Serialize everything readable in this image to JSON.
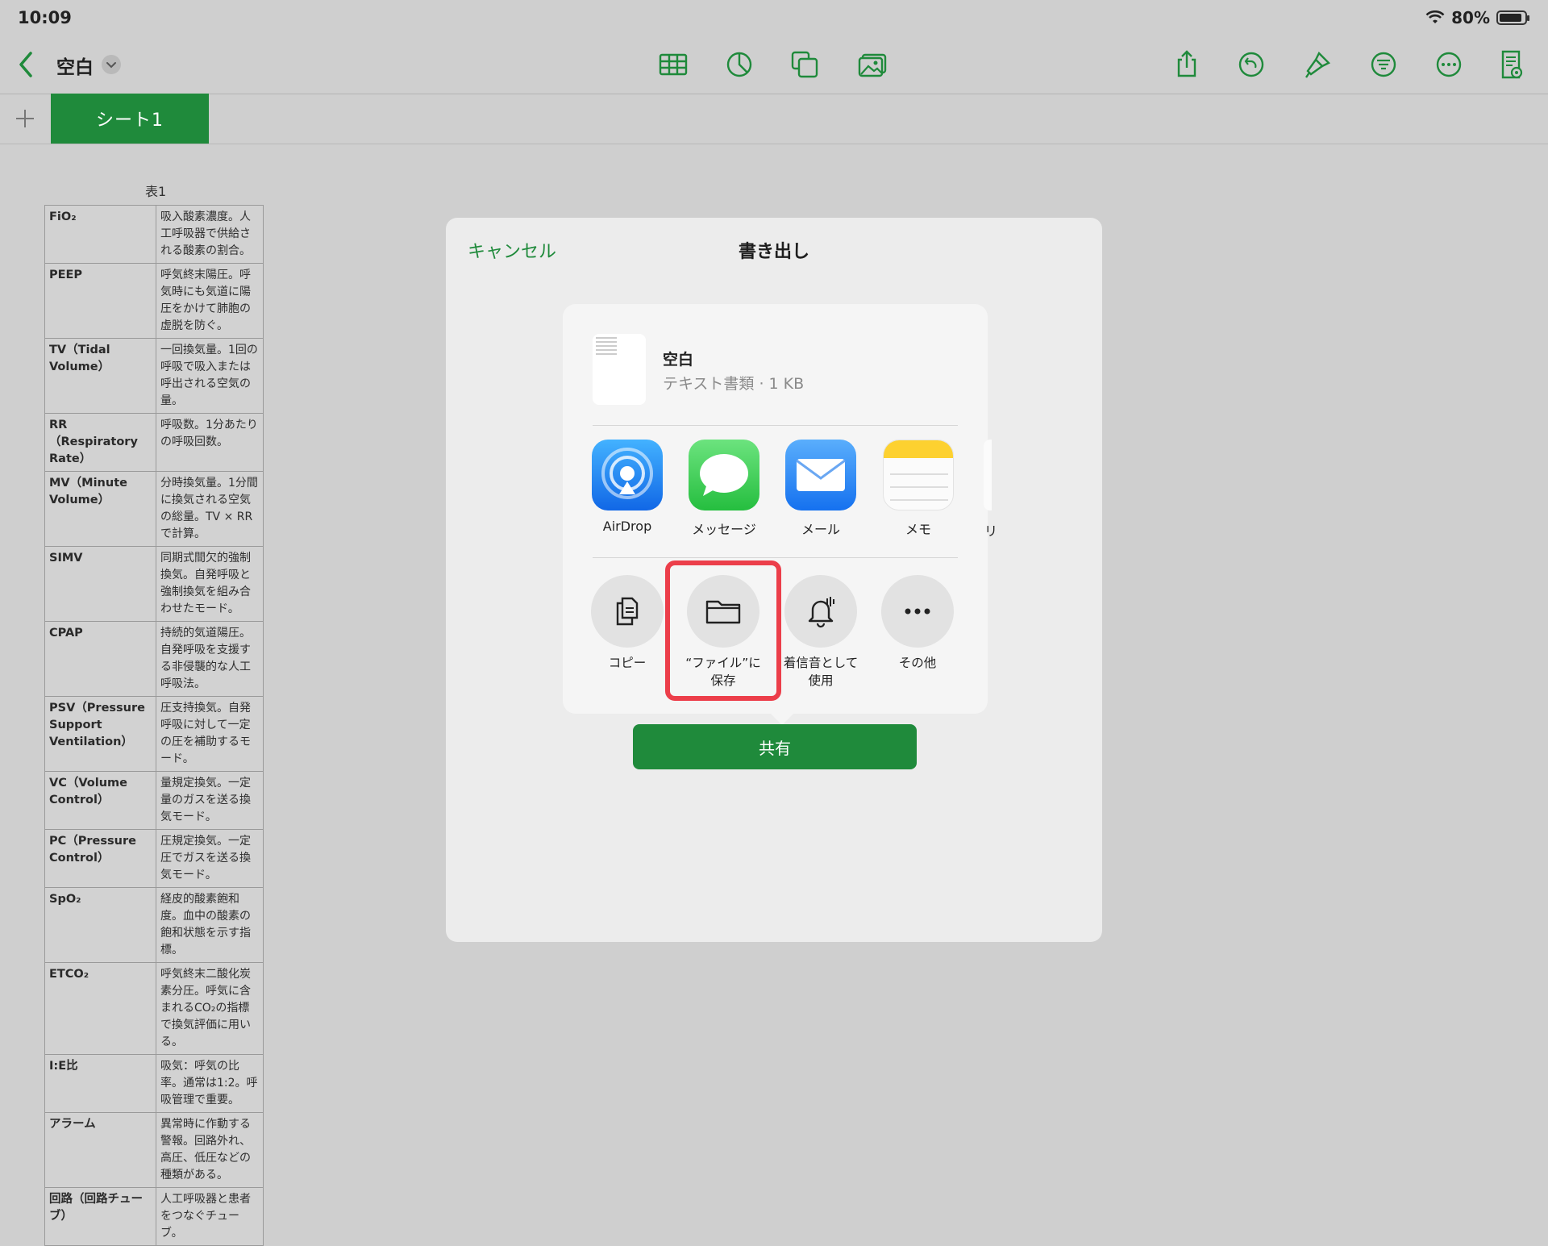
{
  "status": {
    "time": "10:09",
    "battery": "80%"
  },
  "toolbar": {
    "title": "空白"
  },
  "tabs": {
    "sheet_name": "シート1"
  },
  "table": {
    "title": "表1",
    "rows": [
      {
        "term": "FiO₂",
        "desc": "吸入酸素濃度。人工呼吸器で供給される酸素の割合。"
      },
      {
        "term": "PEEP",
        "desc": "呼気終末陽圧。呼気時にも気道に陽圧をかけて肺胞の虚脱を防ぐ。"
      },
      {
        "term": "TV（Tidal Volume）",
        "desc": "一回換気量。1回の呼吸で吸入または呼出される空気の量。"
      },
      {
        "term": "RR（Respiratory Rate）",
        "desc": "呼吸数。1分あたりの呼吸回数。"
      },
      {
        "term": "MV（Minute Volume）",
        "desc": "分時換気量。1分間に換気される空気の総量。TV × RRで計算。"
      },
      {
        "term": "SIMV",
        "desc": "同期式間欠的強制換気。自発呼吸と強制換気を組み合わせたモード。"
      },
      {
        "term": "CPAP",
        "desc": "持続的気道陽圧。自発呼吸を支援する非侵襲的な人工呼吸法。"
      },
      {
        "term": "PSV（Pressure Support Ventilation）",
        "desc": "圧支持換気。自発呼吸に対して一定の圧を補助するモード。"
      },
      {
        "term": "VC（Volume Control）",
        "desc": "量規定換気。一定量のガスを送る換気モード。"
      },
      {
        "term": "PC（Pressure Control）",
        "desc": "圧規定換気。一定圧でガスを送る換気モード。"
      },
      {
        "term": "SpO₂",
        "desc": "経皮的酸素飽和度。血中の酸素の飽和状態を示す指標。"
      },
      {
        "term": "ETCO₂",
        "desc": "呼気終末二酸化炭素分圧。呼気に含まれるCO₂の指標で換気評価に用いる。"
      },
      {
        "term": "I:E比",
        "desc": "吸気：呼気の比率。通常は1:2。呼吸管理で重要。"
      },
      {
        "term": "アラーム",
        "desc": "異常時に作動する警報。回路外れ、高圧、低圧などの種類がある。"
      },
      {
        "term": "回路（回路チューブ）",
        "desc": "人工呼吸器と患者をつなぐチューブ。"
      }
    ]
  },
  "dialog": {
    "cancel": "キャンセル",
    "title": "書き出し",
    "file_name": "空白",
    "file_meta": "テキスト書類 · 1 KB",
    "apps": [
      "AirDrop",
      "メッセージ",
      "メール",
      "メモ"
    ],
    "partial_app_label": "リ",
    "actions": {
      "copy": "コピー",
      "save_to_files": "“ファイル”に保存",
      "ringtone": "着信音として使用",
      "more": "その他"
    },
    "share_button": "共有"
  },
  "colors": {
    "accent": "#1f8a3b",
    "highlight": "#ec3e4a"
  }
}
